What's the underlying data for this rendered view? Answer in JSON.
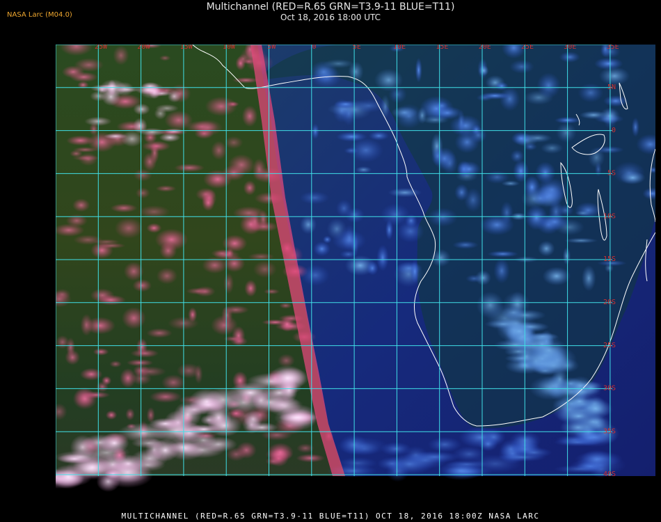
{
  "header": {
    "brand": "NASA Larc (M04.0)",
    "title": "Multichannel (RED=R.65 GRN=T3.9-11 BLUE=T11)",
    "datetime": "Oct 18, 2016 18:00 UTC"
  },
  "map": {
    "lon_labels": [
      "25W",
      "20W",
      "15W",
      "10W",
      "5W",
      "0",
      "5E",
      "10E",
      "15E",
      "20E",
      "25E",
      "30E",
      "35E"
    ],
    "lat_labels": [
      "5N",
      "0",
      "5S",
      "10S",
      "15S",
      "20S",
      "25S",
      "30S",
      "35S",
      "40S"
    ],
    "colors": {
      "grid": "#40e0e8",
      "coast": "#ffffff",
      "label": "#d23030",
      "ocean_left": "#1f4a22",
      "cloud_pink": "#d94a78",
      "ocean_right": "#1a2a88",
      "land": "#103a30",
      "cloud_blue": "#3a6fd8"
    }
  },
  "footer": {
    "text": "MULTICHANNEL (RED=R.65 GRN=T3.9-11 BLUE=T11) OCT 18, 2016 18:00Z NASA LARC"
  }
}
